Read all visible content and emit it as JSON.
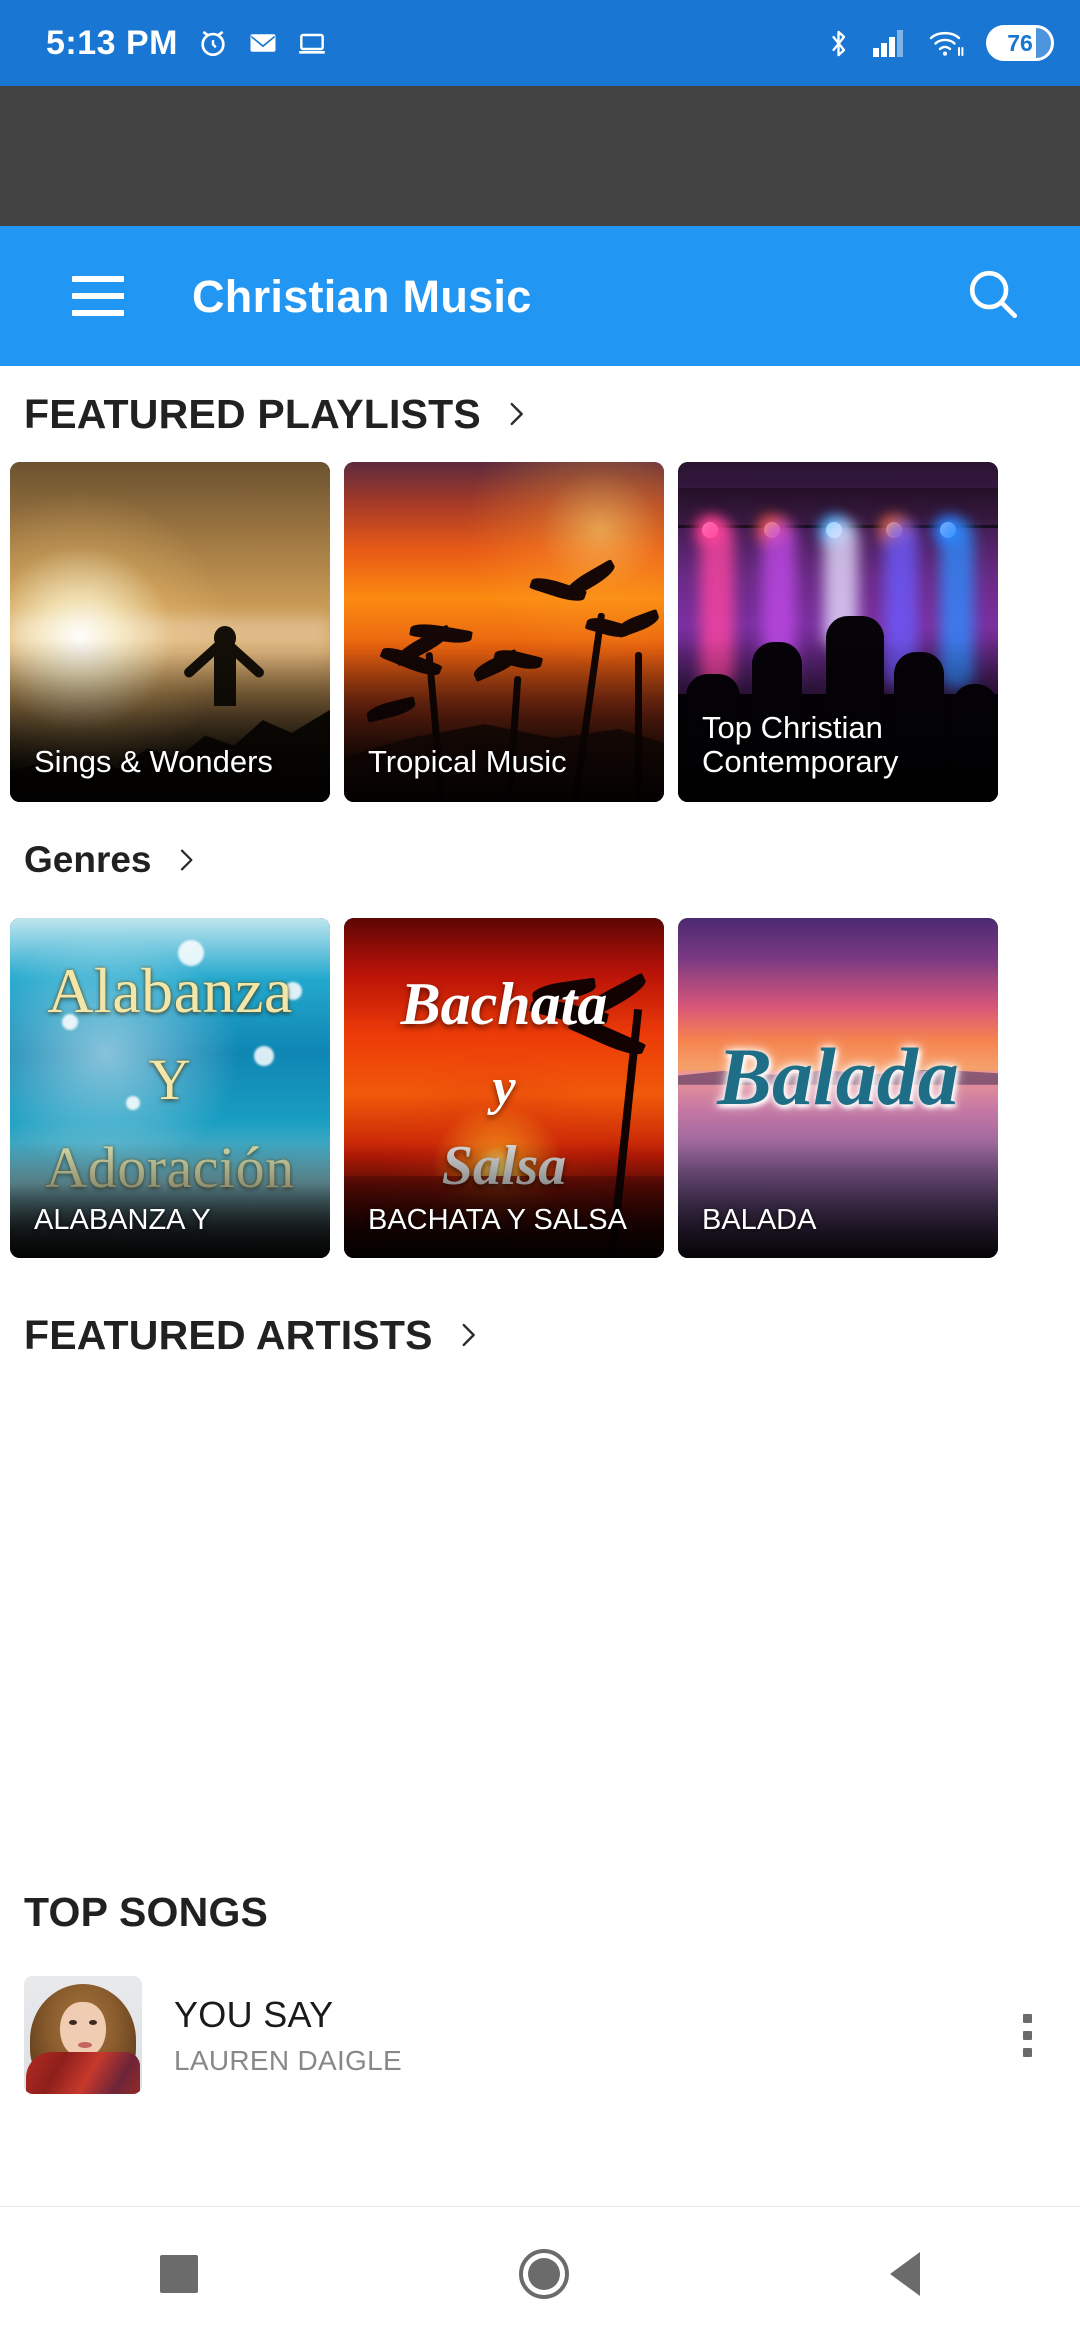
{
  "status_bar": {
    "time": "5:13 PM",
    "left_icons": [
      "alarm-icon",
      "gmail-icon",
      "cast-screen-icon"
    ],
    "right_icons": [
      "bluetooth-icon",
      "signal-icon",
      "wifi-icon"
    ],
    "battery_level": "76",
    "background_color": "#1976D2"
  },
  "ad_banner": {
    "background_color": "#434343"
  },
  "app_bar": {
    "menu_icon": "hamburger-menu-icon",
    "title": "Christian Music",
    "search_icon": "search-icon",
    "background_color": "#2196F3"
  },
  "sections": {
    "featured_playlists": {
      "title": "FEATURED PLAYLISTS",
      "arrow_icon": "chevron-right-icon",
      "cards": [
        {
          "label": "Sings & Wonders",
          "art": "sunrise-worship-silhouette"
        },
        {
          "label": "Tropical Music",
          "art": "tropical-sunset-palms"
        },
        {
          "label": "Top Christian Contemporary",
          "art": "concert-raised-hands"
        }
      ]
    },
    "genres": {
      "title": "Genres",
      "arrow_icon": "chevron-right-icon",
      "cards": [
        {
          "label": "ALABANZA Y",
          "art": "alabanza-y-adoracion-teal",
          "art_text": {
            "line1": "Alabanza",
            "line2": "Y",
            "line3": "Adoración"
          }
        },
        {
          "label": "BACHATA Y SALSA",
          "art": "bachata-y-salsa-red-sunset",
          "art_text": {
            "line1": "Bachata",
            "line2": "y",
            "line3": "Salsa"
          }
        },
        {
          "label": "BALADA",
          "art": "balada-purple-sunset",
          "art_text": {
            "line1": "Balada"
          }
        }
      ]
    },
    "featured_artists": {
      "title": "FEATURED ARTISTS",
      "arrow_icon": "chevron-right-icon",
      "items": []
    },
    "top_songs": {
      "title": "TOP SONGS",
      "songs": [
        {
          "title": "YOU SAY",
          "artist": "LAUREN DAIGLE",
          "thumbnail": "lauren-daigle-portrait",
          "more_icon": "overflow-menu-icon"
        }
      ]
    }
  },
  "nav_bar": {
    "recents_icon": "recents-square-icon",
    "home_icon": "home-circle-icon",
    "back_icon": "back-triangle-icon"
  }
}
